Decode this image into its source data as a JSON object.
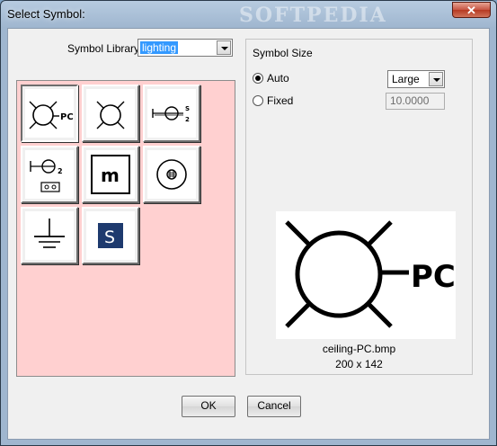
{
  "window": {
    "title": "Select Symbol:",
    "close_glyph": "✕",
    "watermark": "SOFTPEDIA"
  },
  "library": {
    "label": "Symbol Library",
    "selected": "lighting"
  },
  "symbols": [
    {
      "icon": "ceiling-light-pc-icon",
      "selected": true
    },
    {
      "icon": "ceiling-light-icon",
      "selected": false
    },
    {
      "icon": "wall-light-s2-icon",
      "selected": false
    },
    {
      "icon": "wall-light-2-switch-icon",
      "selected": false
    },
    {
      "icon": "m-box-icon",
      "selected": false
    },
    {
      "icon": "downlight-icon",
      "selected": false
    },
    {
      "icon": "earth-ground-icon",
      "selected": false
    },
    {
      "icon": "s-logo-icon",
      "selected": false
    }
  ],
  "symbol_size": {
    "label": "Symbol Size",
    "auto_label": "Auto",
    "fixed_label": "Fixed",
    "mode": "auto",
    "size_selected": "Large",
    "fixed_value": "10.0000"
  },
  "preview": {
    "filename": "ceiling-PC.bmp",
    "dimensions": "200 x 142"
  },
  "buttons": {
    "ok": "OK",
    "cancel": "Cancel"
  },
  "colors": {
    "palette_bg": "#ffd0d0",
    "selection": "#3399ff",
    "s_logo": "#1e3a6e"
  }
}
